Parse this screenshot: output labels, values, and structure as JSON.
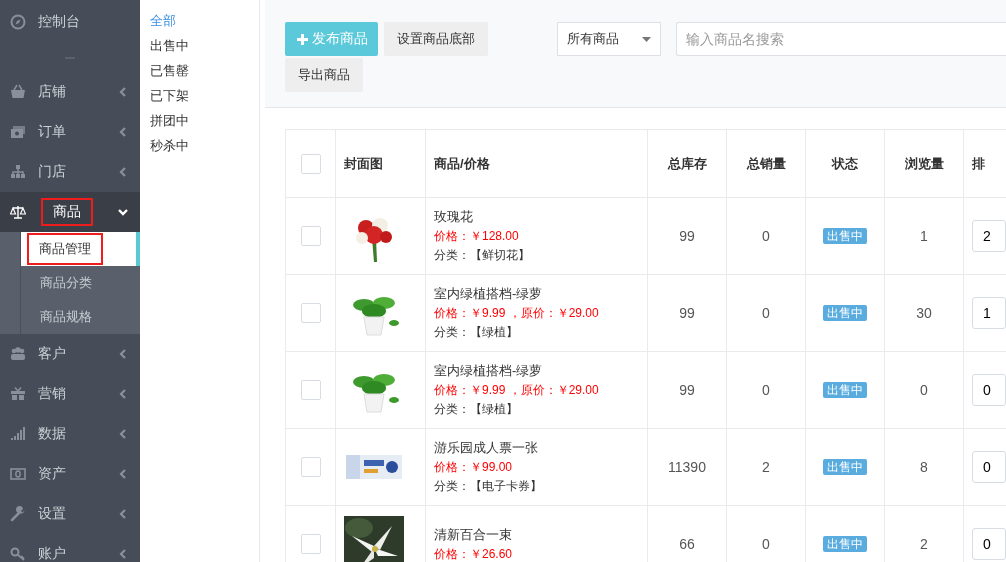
{
  "sidebar": {
    "items": [
      {
        "label": "控制台",
        "selected": false
      },
      {
        "label": "店铺",
        "expanded": false,
        "selected": false
      },
      {
        "label": "订单",
        "expanded": false,
        "selected": false
      },
      {
        "label": "门店",
        "expanded": false,
        "selected": false
      },
      {
        "label": "商品",
        "expanded": true,
        "selected": true,
        "annotated": true,
        "children": [
          {
            "label": "商品管理",
            "selected": true,
            "annotated": true
          },
          {
            "label": "商品分类",
            "selected": false,
            "annotated": false
          },
          {
            "label": "商品规格",
            "selected": false,
            "annotated": false
          }
        ]
      },
      {
        "label": "客户",
        "expanded": false,
        "selected": false
      },
      {
        "label": "营销",
        "expanded": false,
        "selected": false
      },
      {
        "label": "数据",
        "expanded": false,
        "selected": false
      },
      {
        "label": "资产",
        "expanded": false,
        "selected": false
      },
      {
        "label": "设置",
        "expanded": false,
        "selected": false
      },
      {
        "label": "账户",
        "expanded": false,
        "selected": false
      }
    ]
  },
  "filters": [
    {
      "label": "全部",
      "selected": true
    },
    {
      "label": "出售中",
      "selected": false
    },
    {
      "label": "已售罄",
      "selected": false
    },
    {
      "label": "已下架",
      "selected": false
    },
    {
      "label": "拼团中",
      "selected": false
    },
    {
      "label": "秒杀中",
      "selected": false
    }
  ],
  "toolbar": {
    "buttons": [
      {
        "label": "发布商品",
        "kind": "primary"
      },
      {
        "label": "设置商品底部",
        "kind": "default"
      },
      {
        "label": "导出商品",
        "kind": "default"
      }
    ],
    "select": {
      "value": "所有商品"
    },
    "search": {
      "placeholder": "输入商品名搜索"
    }
  },
  "table": {
    "select_all": {
      "checked": false
    },
    "columns": [
      "封面图",
      "商品/价格",
      "总库存",
      "总销量",
      "状态",
      "浏览量",
      "排"
    ],
    "rows": [
      {
        "checked": false,
        "name": "玫瑰花",
        "price": "价格：￥128.00",
        "category": "分类：【鲜切花】",
        "stock": "99",
        "sales": "0",
        "status": "出售中",
        "views": "1",
        "sort": "2"
      },
      {
        "checked": false,
        "name": "室内绿植搭档-绿萝",
        "price": "价格：￥9.99 ，原价：￥29.00",
        "category": "分类：【绿植】",
        "stock": "99",
        "sales": "0",
        "status": "出售中",
        "views": "30",
        "sort": "1"
      },
      {
        "checked": false,
        "name": "室内绿植搭档-绿萝",
        "price": "价格：￥9.99 ，原价：￥29.00",
        "category": "分类：【绿植】",
        "stock": "99",
        "sales": "0",
        "status": "出售中",
        "views": "0",
        "sort": "0"
      },
      {
        "checked": false,
        "name": "游乐园成人票一张",
        "price": "价格：￥99.00",
        "category": "分类：【电子卡券】",
        "stock": "11390",
        "sales": "2",
        "status": "出售中",
        "views": "8",
        "sort": "0"
      },
      {
        "checked": false,
        "name": "清新百合一束",
        "price": "价格：￥26.60",
        "stock": "66",
        "sales": "0",
        "status": "出售中",
        "views": "2",
        "sort": "0"
      }
    ]
  }
}
